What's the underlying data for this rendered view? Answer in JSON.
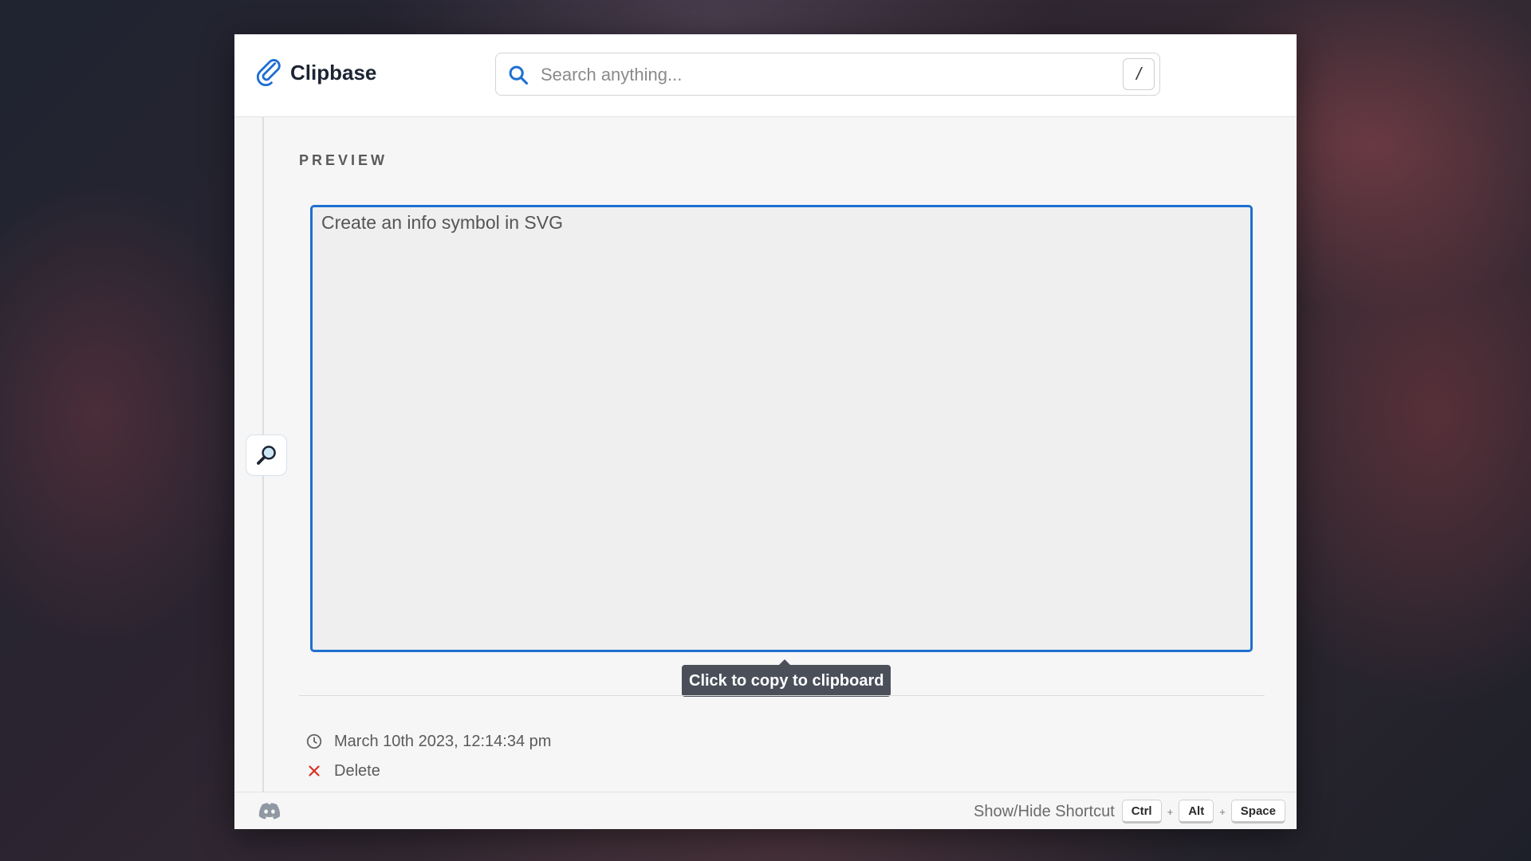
{
  "app": {
    "name": "Clipbase",
    "accent_color": "#1f6fd1"
  },
  "search": {
    "placeholder": "Search anything...",
    "shortcut_key": "/",
    "value": ""
  },
  "sidebar": {
    "icon": "magnifier-icon"
  },
  "preview": {
    "section_label": "PREVIEW",
    "content": "Create an info symbol in SVG",
    "tooltip": "Click to copy to clipboard"
  },
  "details": {
    "timestamp": "March 10th 2023, 12:14:34 pm",
    "delete_label": "Delete",
    "delete_color": "#d93025"
  },
  "footer": {
    "icon": "discord-icon",
    "shortcut_label": "Show/Hide Shortcut",
    "keys": [
      "Ctrl",
      "Alt",
      "Space"
    ],
    "separator": "+"
  }
}
